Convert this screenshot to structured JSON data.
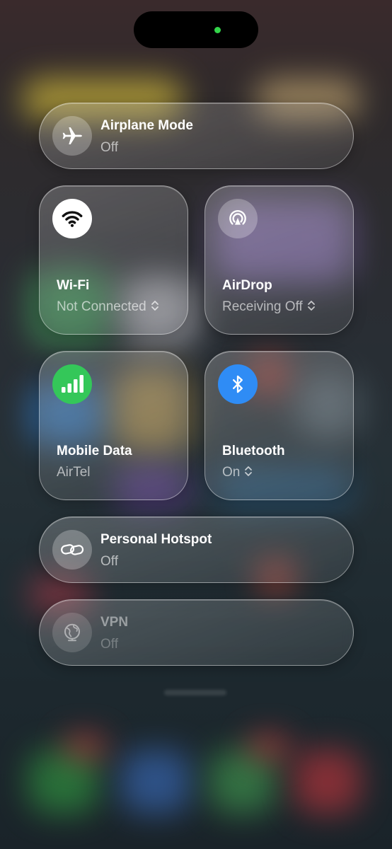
{
  "status": {
    "indicator_color": "#33d54a"
  },
  "controls": {
    "airplane": {
      "title": "Airplane Mode",
      "status": "Off",
      "icon": "airplane-icon"
    },
    "wifi": {
      "title": "Wi-Fi",
      "status": "Not Connected",
      "icon": "wifi-icon"
    },
    "airdrop": {
      "title": "AirDrop",
      "status": "Receiving Off",
      "icon": "airdrop-icon"
    },
    "mobile_data": {
      "title": "Mobile Data",
      "status": "AirTel",
      "icon": "cellular-signal-icon",
      "color": "#34c759"
    },
    "bluetooth": {
      "title": "Bluetooth",
      "status": "On",
      "icon": "bluetooth-icon",
      "color": "#2f8cf5"
    },
    "hotspot": {
      "title": "Personal Hotspot",
      "status": "Off",
      "icon": "link-icon"
    },
    "vpn": {
      "title": "VPN",
      "status": "Off",
      "icon": "globe-icon"
    }
  }
}
